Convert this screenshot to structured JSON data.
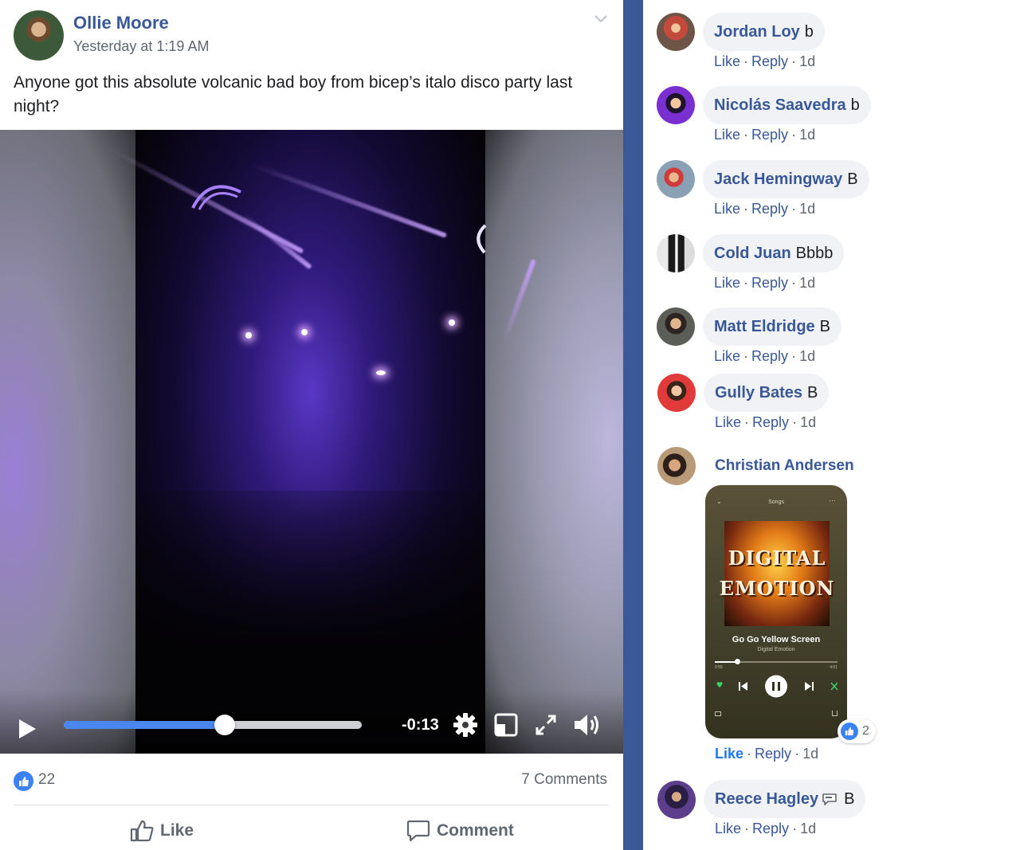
{
  "post": {
    "author": "Ollie Moore",
    "timestamp": "Yesterday at 1:19 AM",
    "menu_icon": "chevron-down-icon",
    "text": "Anyone got this absolute volcanic bad boy from bicep’s italo disco party last night?",
    "video": {
      "time_remaining": "-0:13",
      "progress_fraction": 0.54,
      "icons": [
        "play-icon",
        "settings-icon",
        "picture-in-picture-icon",
        "fullscreen-icon",
        "volume-icon"
      ]
    },
    "likes": "22",
    "comments_count": "7 Comments",
    "actions": {
      "like": "Like",
      "comment": "Comment"
    }
  },
  "comments": [
    {
      "name": "Jordan Loy",
      "text": "b",
      "like": "Like",
      "reply": "Reply",
      "age": "1d"
    },
    {
      "name": "Nicolás Saavedra",
      "text": "b",
      "like": "Like",
      "reply": "Reply",
      "age": "1d"
    },
    {
      "name": "Jack Hemingway",
      "text": "B",
      "like": "Like",
      "reply": "Reply",
      "age": "1d"
    },
    {
      "name": "Cold Juan",
      "text": "Bbbb",
      "like": "Like",
      "reply": "Reply",
      "age": "1d"
    },
    {
      "name": "Matt Eldridge",
      "text": "B",
      "like": "Like",
      "reply": "Reply",
      "age": "1d"
    },
    {
      "name": "Gully Bates",
      "text": "B",
      "like": "Like",
      "reply": "Reply",
      "age": "1d"
    },
    {
      "name": "Christian Andersen",
      "attachment": {
        "header": "Songs",
        "album_line1": "DIGITAL",
        "album_line2": "EMOTION",
        "song": "Go Go Yellow Screen",
        "artist": "Digital Emotion",
        "elapsed": "0:55",
        "duration": "4:01",
        "progress_fraction": 0.18
      },
      "reactions": "2",
      "like": "Like",
      "reply": "Reply",
      "age": "1d"
    },
    {
      "name": "Reece Hagley",
      "text": "B",
      "like": "Like",
      "reply": "Reply",
      "age": "1d",
      "emoji_icon": "speech-bubble-icon"
    }
  ],
  "colors": {
    "brand_blue": "#3b5998",
    "link_blue": "#385898",
    "progress_blue": "#4a86f0",
    "like_blue": "#3b82f6"
  }
}
